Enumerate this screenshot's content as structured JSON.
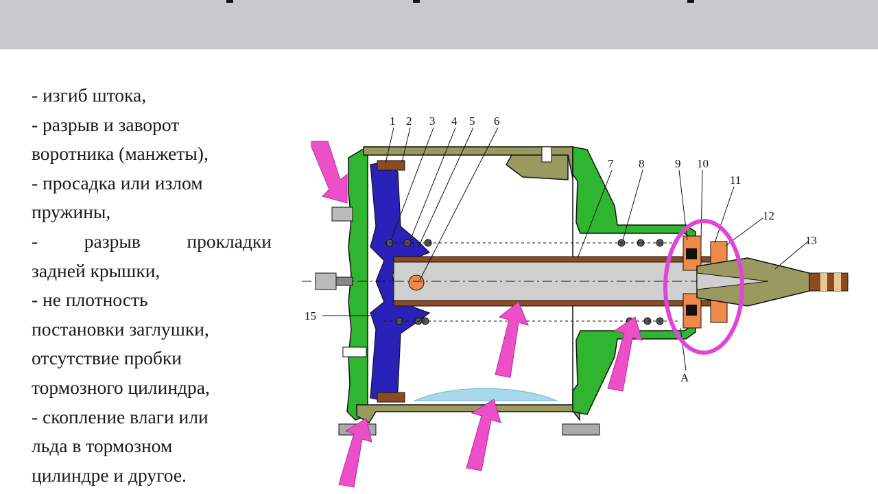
{
  "lines": [
    "- изгиб штока,",
    "- разрыв и заворот",
    "воротника (манжеты),",
    "- просадка или излом",
    "пружины,",
    "-  разрыв  прокладки",
    "задней крышки,",
    "- не плотность",
    "постановки заглушки,",
    "отсутствие пробки",
    "тормозного цилиндра,",
    "- скопление влаги или",
    "льда в тормозном",
    "цилиндре и другое."
  ],
  "diagram": {
    "callout_numbers": [
      "1",
      "2",
      "3",
      "4",
      "5",
      "6",
      "7",
      "8",
      "9",
      "10",
      "11",
      "12",
      "13",
      "15"
    ],
    "label_a": "A",
    "colors": {
      "header": "#c7c9cc",
      "body_green": "#2fb52f",
      "olive": "#9a9a60",
      "piston_blue": "#2a22b8",
      "rod_brown": "#8b4a22",
      "rod_fill": "#cfcfcf",
      "arrow_pink": "#ec4fc8",
      "circle_magenta": "#e045d8",
      "ice_blue": "#a8d8ea"
    },
    "icons": [
      "pink-arrow",
      "highlight-circle"
    ]
  }
}
